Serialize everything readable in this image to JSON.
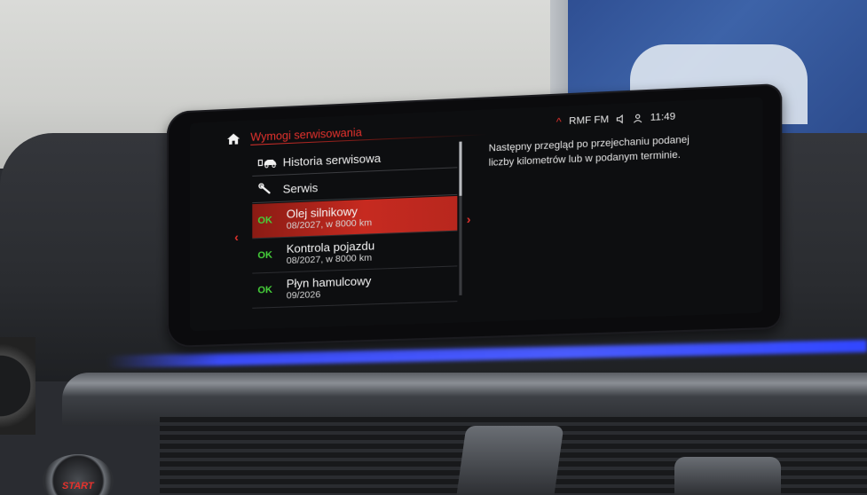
{
  "header": {
    "title": "Wymogi serwisowania",
    "source": "RMF FM",
    "time": "11:49"
  },
  "menu": {
    "items": [
      {
        "label": "Historia serwisowa",
        "icon": "car-history-icon"
      },
      {
        "label": "Serwis",
        "icon": "wrench-icon"
      }
    ],
    "services": [
      {
        "status": "OK",
        "name": "Olej silnikowy",
        "detail": "08/2027, w 8000 km",
        "selected": true
      },
      {
        "status": "OK",
        "name": "Kontrola pojazdu",
        "detail": "08/2027, w 8000 km",
        "selected": false
      },
      {
        "status": "OK",
        "name": "Płyn hamulcowy",
        "detail": "09/2026",
        "selected": false
      }
    ]
  },
  "info": {
    "text": "Następny przegląd po przejechaniu podanej liczby kilometrów lub w podanym terminie."
  },
  "dashboard": {
    "start_label": "START"
  },
  "colors": {
    "accent": "#e5322d",
    "ok": "#46d13a",
    "ambient": "#3b4dff"
  }
}
